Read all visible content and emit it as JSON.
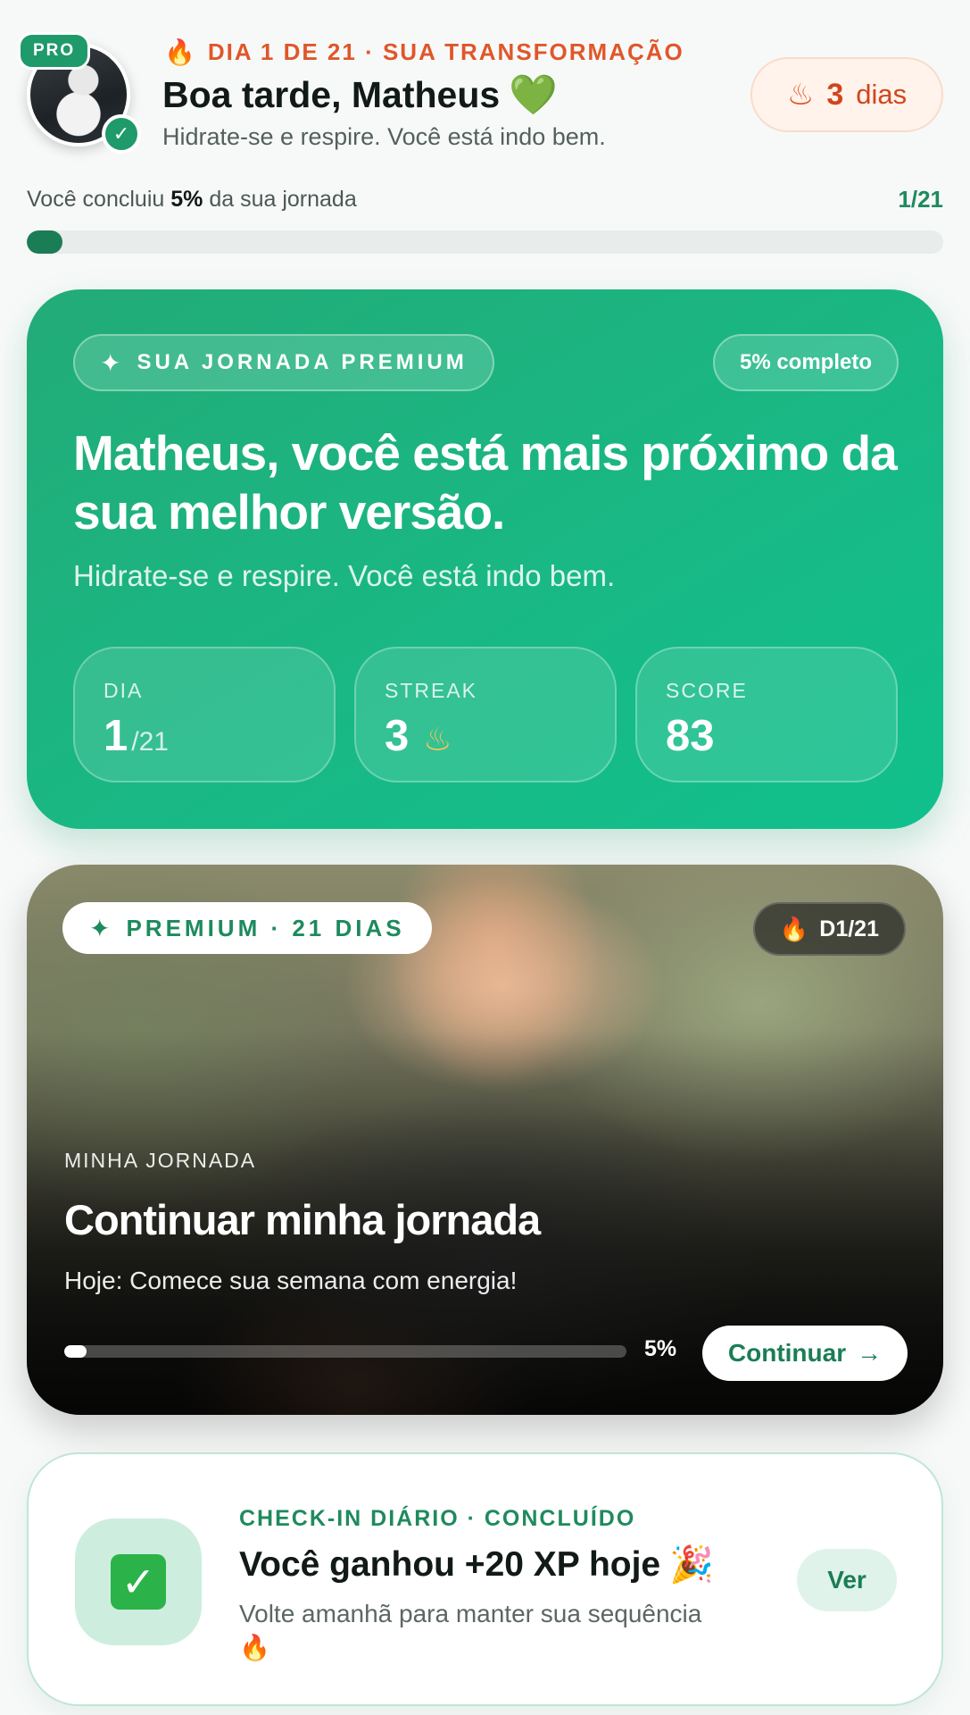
{
  "header": {
    "pro_badge": "PRO",
    "eyebrow": "DIA 1 DE 21 · SUA TRANSFORMAÇÃO",
    "eyebrow_icon": "flame-icon",
    "greeting": "Boa tarde, Matheus",
    "greeting_emoji": "💚",
    "subtitle": "Hidrate-se e respire. Você está indo bem.",
    "streak_value": "3",
    "streak_unit": "dias",
    "streak_icon": "flame-outline-icon"
  },
  "progress": {
    "text_prefix": "Você concluiu",
    "percent_text": "5%",
    "text_suffix": "da sua jornada",
    "count": "1/21",
    "fraction": 0.05
  },
  "premium": {
    "chip_label": "SUA JORNADA PREMIUM",
    "chip_icon": "sparkles-icon",
    "completion": "5% completo",
    "headline": "Matheus, você está mais próximo da sua melhor versão.",
    "subtitle": "Hidrate-se e respire. Você está indo bem.",
    "stats": [
      {
        "label": "DIA",
        "value": "1",
        "suffix": "/21"
      },
      {
        "label": "STREAK",
        "value": "3",
        "icon": "flame-outline-icon"
      },
      {
        "label": "SCORE",
        "value": "83"
      }
    ]
  },
  "journey": {
    "chip_label": "PREMIUM · 21 DIAS",
    "chip_icon": "sparkles-icon",
    "day_badge": "D1/21",
    "eyebrow": "MINHA JORNADA",
    "title": "Continuar minha jornada",
    "subtitle": "Hoje: Comece sua semana com energia!",
    "percent": "5%",
    "fraction": 0.05,
    "button_label": "Continuar",
    "button_icon": "arrow-right-icon"
  },
  "checkin": {
    "eyebrow": "CHECK-IN DIÁRIO · CONCLUÍDO",
    "title": "Você ganhou +20 XP hoje",
    "title_emoji": "🎉",
    "subtitle": "Volte amanhã para manter sua sequência",
    "subtitle_emoji": "🔥",
    "button_label": "Ver",
    "icon": "check-box-icon"
  },
  "colors": {
    "accent": "#1f9a6a",
    "streak_orange": "#e0562a",
    "card_green": "#19b884"
  }
}
